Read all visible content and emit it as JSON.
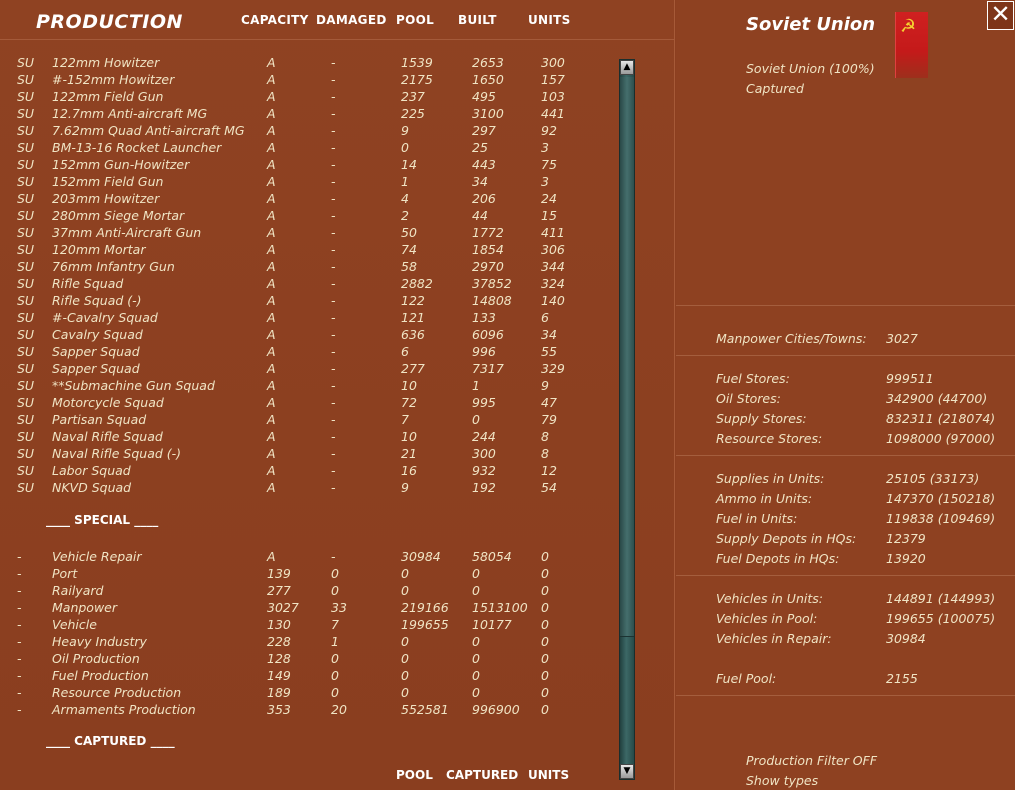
{
  "header": {
    "title": "PRODUCTION",
    "columns": [
      "CAPACITY",
      "DAMAGED",
      "POOL",
      "BUILT",
      "UNITS"
    ]
  },
  "rows": [
    [
      "SU",
      "122mm Howitzer",
      "A",
      "-",
      "1539",
      "2653",
      "300"
    ],
    [
      "SU",
      "#-152mm Howitzer",
      "A",
      "-",
      "2175",
      "1650",
      "157"
    ],
    [
      "SU",
      "122mm Field Gun",
      "A",
      "-",
      "237",
      "495",
      "103"
    ],
    [
      "SU",
      "12.7mm Anti-aircraft MG",
      "A",
      "-",
      "225",
      "3100",
      "441"
    ],
    [
      "SU",
      "7.62mm Quad Anti-aircraft MG",
      "A",
      "-",
      "9",
      "297",
      "92"
    ],
    [
      "SU",
      "BM-13-16 Rocket Launcher",
      "A",
      "-",
      "0",
      "25",
      "3"
    ],
    [
      "SU",
      "152mm Gun-Howitzer",
      "A",
      "-",
      "14",
      "443",
      "75"
    ],
    [
      "SU",
      "152mm Field Gun",
      "A",
      "-",
      "1",
      "34",
      "3"
    ],
    [
      "SU",
      "203mm Howitzer",
      "A",
      "-",
      "4",
      "206",
      "24"
    ],
    [
      "SU",
      "280mm Siege Mortar",
      "A",
      "-",
      "2",
      "44",
      "15"
    ],
    [
      "SU",
      "37mm Anti-Aircraft Gun",
      "A",
      "-",
      "50",
      "1772",
      "411"
    ],
    [
      "SU",
      "120mm Mortar",
      "A",
      "-",
      "74",
      "1854",
      "306"
    ],
    [
      "SU",
      "76mm Infantry Gun",
      "A",
      "-",
      "58",
      "2970",
      "344"
    ],
    [
      "SU",
      "Rifle Squad",
      "A",
      "-",
      "2882",
      "37852",
      "324"
    ],
    [
      "SU",
      "Rifle Squad (-)",
      "A",
      "-",
      "122",
      "14808",
      "140"
    ],
    [
      "SU",
      "#-Cavalry Squad",
      "A",
      "-",
      "121",
      "133",
      "6"
    ],
    [
      "SU",
      "Cavalry Squad",
      "A",
      "-",
      "636",
      "6096",
      "34"
    ],
    [
      "SU",
      "Sapper Squad",
      "A",
      "-",
      "6",
      "996",
      "55"
    ],
    [
      "SU",
      "Sapper Squad",
      "A",
      "-",
      "277",
      "7317",
      "329"
    ],
    [
      "SU",
      "**Submachine Gun Squad",
      "A",
      "-",
      "10",
      "1",
      "9"
    ],
    [
      "SU",
      "Motorcycle Squad",
      "A",
      "-",
      "72",
      "995",
      "47"
    ],
    [
      "SU",
      "Partisan Squad",
      "A",
      "-",
      "7",
      "0",
      "79"
    ],
    [
      "SU",
      "Naval Rifle Squad",
      "A",
      "-",
      "10",
      "244",
      "8"
    ],
    [
      "SU",
      "Naval Rifle Squad (-)",
      "A",
      "-",
      "21",
      "300",
      "8"
    ],
    [
      "SU",
      "Labor Squad",
      "A",
      "-",
      "16",
      "932",
      "12"
    ],
    [
      "SU",
      "NKVD Squad",
      "A",
      "-",
      "9",
      "192",
      "54"
    ]
  ],
  "special_heading": "____ SPECIAL ____",
  "special_rows": [
    [
      "-",
      "Vehicle Repair",
      "A",
      "-",
      "30984",
      "58054",
      "0"
    ],
    [
      "-",
      "Port",
      "139",
      "0",
      "0",
      "0",
      "0"
    ],
    [
      "-",
      "Railyard",
      "277",
      "0",
      "0",
      "0",
      "0"
    ],
    [
      "-",
      "Manpower",
      "3027",
      "33",
      "219166",
      "1513100",
      "0"
    ],
    [
      "-",
      "Vehicle",
      "130",
      "7",
      "199655",
      "10177",
      "0"
    ],
    [
      "-",
      "Heavy Industry",
      "228",
      "1",
      "0",
      "0",
      "0"
    ],
    [
      "-",
      "Oil Production",
      "128",
      "0",
      "0",
      "0",
      "0"
    ],
    [
      "-",
      "Fuel Production",
      "149",
      "0",
      "0",
      "0",
      "0"
    ],
    [
      "-",
      "Resource Production",
      "189",
      "0",
      "0",
      "0",
      "0"
    ],
    [
      "-",
      "Armaments Production",
      "353",
      "20",
      "552581",
      "996900",
      "0"
    ]
  ],
  "captured_heading": "____ CAPTURED ____",
  "footer_columns": [
    "POOL",
    "CAPTURED",
    "UNITS"
  ],
  "scrollbar": {
    "up": "▲",
    "down": "▼"
  },
  "close_label": "✕",
  "nation": {
    "title": "Soviet Union",
    "line1": "Soviet Union  (100%)",
    "line2": "Captured",
    "flag_emblem": "☭",
    "flag_color": "#cc1e1e"
  },
  "stats": {
    "manpower": [
      [
        "Manpower Cities/Towns:",
        "3027"
      ]
    ],
    "stores": [
      [
        "Fuel Stores:",
        "999511"
      ],
      [
        "Oil Stores:",
        "342900 (44700)"
      ],
      [
        "Supply Stores:",
        "832311 (218074)"
      ],
      [
        "Resource Stores:",
        "1098000 (97000)"
      ]
    ],
    "units": [
      [
        "Supplies in Units:",
        "25105 (33173)"
      ],
      [
        "Ammo in Units:",
        "147370 (150218)"
      ],
      [
        "Fuel in Units:",
        "119838 (109469)"
      ],
      [
        "Supply Depots in HQs:",
        "12379"
      ],
      [
        "Fuel Depots in HQs:",
        "13920"
      ]
    ],
    "vehicles": [
      [
        "Vehicles in Units:",
        "144891 (144993)"
      ],
      [
        "Vehicles in Pool:",
        "199655 (100075)"
      ],
      [
        "Vehicles in Repair:",
        "30984"
      ]
    ],
    "fuel_pool": [
      [
        "Fuel Pool:",
        "2155"
      ]
    ]
  },
  "filters": {
    "production_filter": "Production Filter OFF",
    "show_types": "Show types"
  },
  "colors": {
    "background": "#8c3f20",
    "text": "#f0e4c4",
    "heading": "#ffffff",
    "scrollbar": "#3c6866"
  }
}
